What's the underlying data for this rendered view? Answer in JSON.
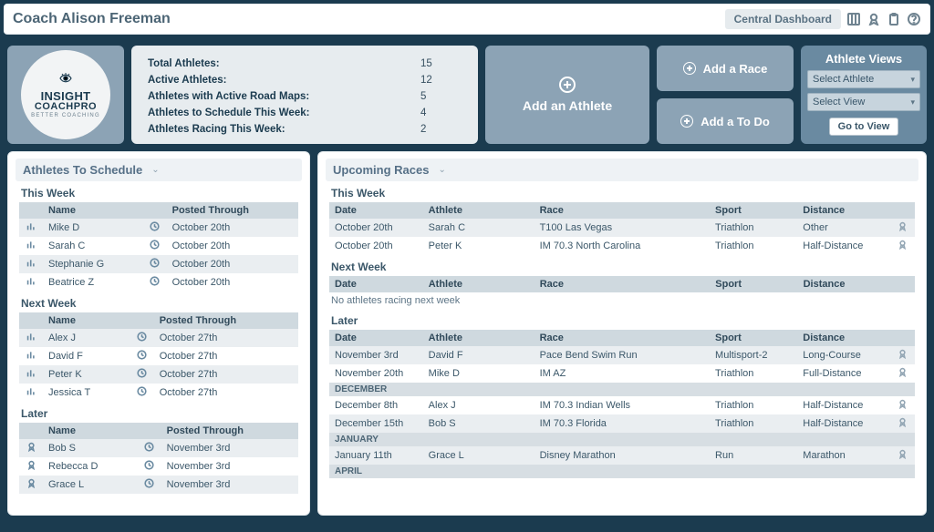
{
  "header": {
    "title": "Coach Alison Freeman",
    "dashboard_pill": "Central Dashboard"
  },
  "logo": {
    "line1": "INSIGHT",
    "line2": "COACHPRO",
    "line3": "BETTER COACHING"
  },
  "stats": {
    "rows": [
      {
        "label": "Total Athletes:",
        "value": "15"
      },
      {
        "label": "Active Athletes:",
        "value": "12"
      },
      {
        "label": "Athletes with Active Road Maps:",
        "value": "5"
      },
      {
        "label": "Athletes to Schedule This Week:",
        "value": "4"
      },
      {
        "label": "Athletes Racing This Week:",
        "value": "2"
      }
    ]
  },
  "actions": {
    "add_athlete": "Add an Athlete",
    "add_race": "Add a Race",
    "add_todo": "Add a To Do"
  },
  "views": {
    "title": "Athlete Views",
    "select_athlete": "Select Athlete",
    "select_view": "Select View",
    "go": "Go to View"
  },
  "schedule": {
    "title": "Athletes To Schedule",
    "h_name": "Name",
    "h_posted": "Posted Through",
    "this_week_label": "This Week",
    "next_week_label": "Next Week",
    "later_label": "Later",
    "this_week": [
      {
        "name": "Mike D",
        "posted": "October 20th"
      },
      {
        "name": "Sarah C",
        "posted": "October 20th"
      },
      {
        "name": "Stephanie G",
        "posted": "October 20th"
      },
      {
        "name": "Beatrice Z",
        "posted": "October 20th"
      }
    ],
    "next_week": [
      {
        "name": "Alex J",
        "posted": "October 27th"
      },
      {
        "name": "David F",
        "posted": "October 27th"
      },
      {
        "name": "Peter K",
        "posted": "October 27th"
      },
      {
        "name": "Jessica T",
        "posted": "October 27th"
      }
    ],
    "later": [
      {
        "name": "Bob S",
        "posted": "November 3rd"
      },
      {
        "name": "Rebecca D",
        "posted": "November 3rd"
      },
      {
        "name": "Grace L",
        "posted": "November 3rd"
      }
    ]
  },
  "races": {
    "title": "Upcoming Races",
    "h_date": "Date",
    "h_athlete": "Athlete",
    "h_race": "Race",
    "h_sport": "Sport",
    "h_distance": "Distance",
    "this_week_label": "This Week",
    "next_week_label": "Next Week",
    "later_label": "Later",
    "empty_text": "No athletes racing next week",
    "month_dec": "DECEMBER",
    "month_jan": "JANUARY",
    "month_apr": "APRIL",
    "this_week": [
      {
        "date": "October 20th",
        "athlete": "Sarah C",
        "race": "T100 Las Vegas",
        "sport": "Triathlon",
        "distance": "Other"
      },
      {
        "date": "October 20th",
        "athlete": "Peter K",
        "race": "IM 70.3 North Carolina",
        "sport": "Triathlon",
        "distance": "Half-Distance"
      }
    ],
    "later": [
      {
        "date": "November 3rd",
        "athlete": "David F",
        "race": "Pace Bend Swim Run",
        "sport": "Multisport-2",
        "distance": "Long-Course"
      },
      {
        "date": "November 20th",
        "athlete": "Mike D",
        "race": "IM AZ",
        "sport": "Triathlon",
        "distance": "Full-Distance"
      },
      {
        "date": "December 8th",
        "athlete": "Alex J",
        "race": "IM 70.3 Indian Wells",
        "sport": "Triathlon",
        "distance": "Half-Distance"
      },
      {
        "date": "December 15th",
        "athlete": "Bob S",
        "race": "IM 70.3 Florida",
        "sport": "Triathlon",
        "distance": "Half-Distance"
      },
      {
        "date": "January 11th",
        "athlete": "Grace L",
        "race": "Disney Marathon",
        "sport": "Run",
        "distance": "Marathon"
      }
    ]
  }
}
